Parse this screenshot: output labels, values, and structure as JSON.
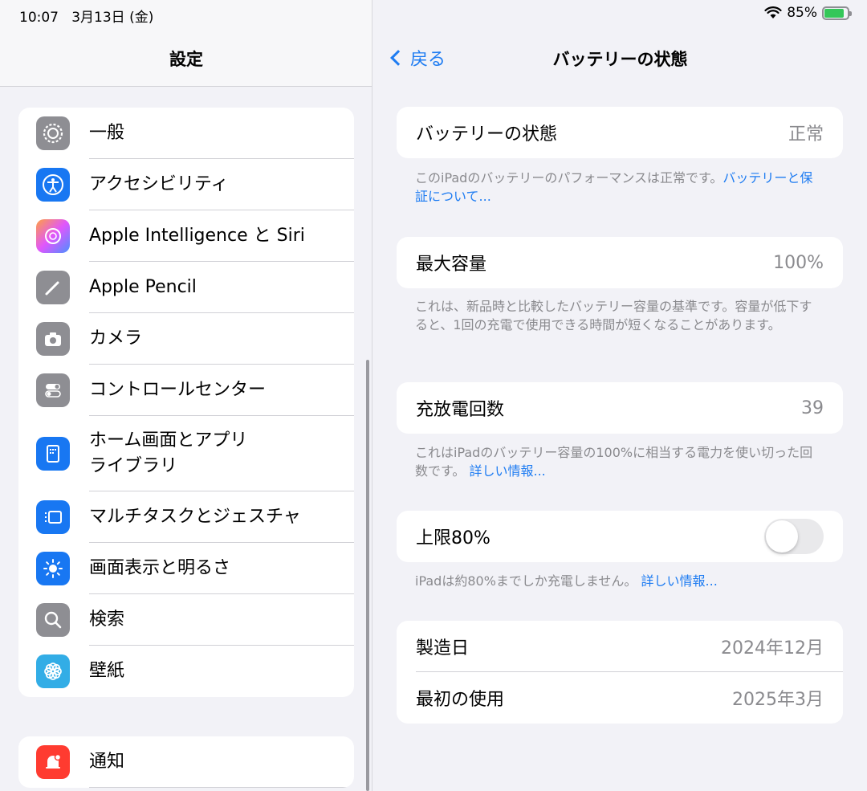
{
  "status": {
    "time": "10:07",
    "date": "3月13日 (金)",
    "battery_percent": "85%",
    "battery_level": 0.85
  },
  "sidebar": {
    "title": "設定",
    "items": [
      {
        "label": "一般",
        "icon": "gear-icon",
        "color": "#8e8e93"
      },
      {
        "label": "アクセシビリティ",
        "icon": "accessibility-icon",
        "color": "#1877f2"
      },
      {
        "label": "Apple Intelligence と Siri",
        "icon": "apple-intelligence-icon",
        "color": "#e06af0"
      },
      {
        "label": "Apple Pencil",
        "icon": "pencil-icon",
        "color": "#8e8e93"
      },
      {
        "label": "カメラ",
        "icon": "camera-icon",
        "color": "#8e8e93"
      },
      {
        "label": "コントロールセンター",
        "icon": "control-center-icon",
        "color": "#8e8e93"
      },
      {
        "label": "ホーム画面とアプリ\nライブラリ",
        "icon": "home-screen-icon",
        "color": "#1877f2"
      },
      {
        "label": "マルチタスクとジェスチャ",
        "icon": "multitasking-icon",
        "color": "#1877f2"
      },
      {
        "label": "画面表示と明るさ",
        "icon": "brightness-icon",
        "color": "#1877f2"
      },
      {
        "label": "検索",
        "icon": "search-icon",
        "color": "#8e8e93"
      },
      {
        "label": "壁紙",
        "icon": "wallpaper-icon",
        "color": "#32ade6"
      }
    ],
    "items2": [
      {
        "label": "通知",
        "icon": "notification-icon",
        "color": "#ff3b30"
      }
    ]
  },
  "detail": {
    "back_label": "戻る",
    "title": "バッテリーの状態",
    "health": {
      "label": "バッテリーの状態",
      "value": "正常"
    },
    "health_note": "このiPadのバッテリーのパフォーマンスは正常です。",
    "health_link": "バッテリーと保証について...",
    "capacity": {
      "label": "最大容量",
      "value": "100%"
    },
    "capacity_note": "これは、新品時と比較したバッテリー容量の基準です。容量が低下すると、1回の充電で使用できる時間が短くなることがあります。",
    "cycles": {
      "label": "充放電回数",
      "value": "39"
    },
    "cycles_note": "これはiPadのバッテリー容量の100%に相当する電力を使い切った回数です。",
    "cycles_link": "詳しい情報...",
    "limit": {
      "label": "上限80%",
      "enabled": false
    },
    "limit_note": "iPadは約80%までしか充電しません。",
    "limit_link": "詳しい情報...",
    "manufactured": {
      "label": "製造日",
      "value": "2024年12月"
    },
    "first_use": {
      "label": "最初の使用",
      "value": "2025年3月"
    }
  }
}
